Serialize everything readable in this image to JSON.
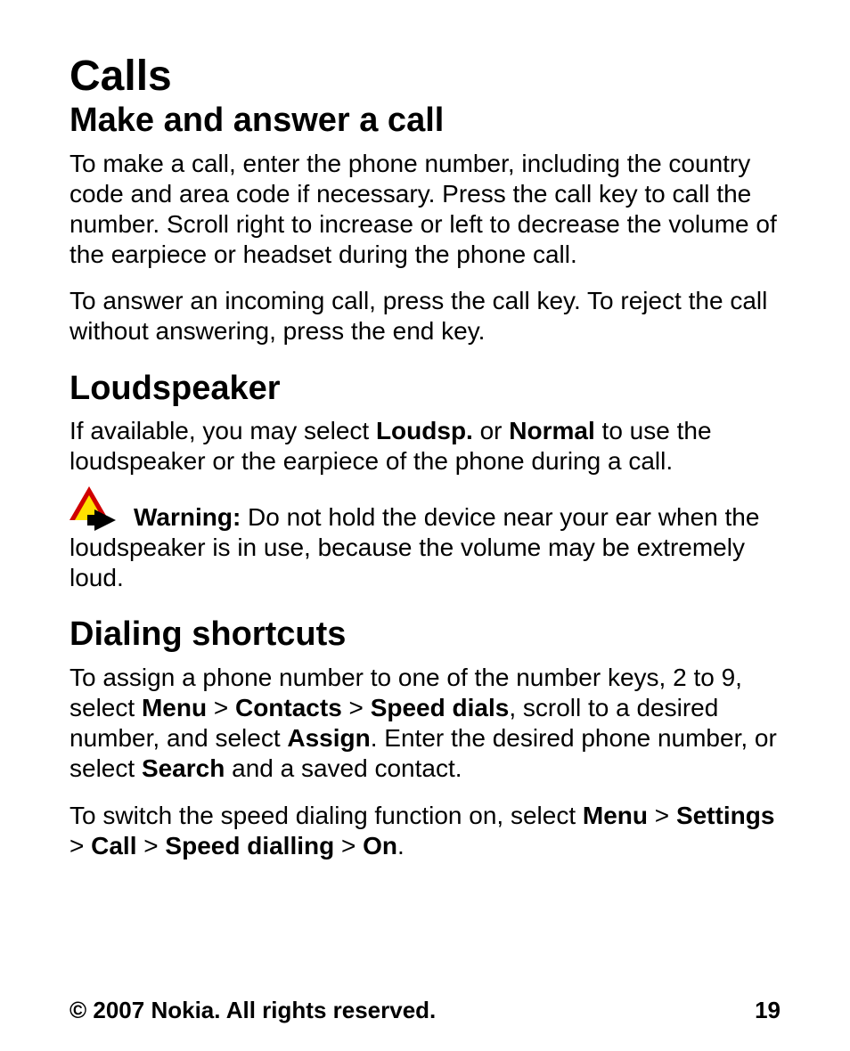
{
  "h1": "Calls",
  "sec1": {
    "title": "Make and answer a call",
    "p1": "To make a call, enter the phone number, including the country code and area code if necessary. Press the call key to call the number. Scroll right to increase or left to decrease the volume of the earpiece or headset during the phone call.",
    "p2": "To answer an incoming call, press the call key. To reject the call without answering, press the end key."
  },
  "sec2": {
    "title": "Loudspeaker",
    "p1_a": "If available, you may select ",
    "p1_b": "Loudsp.",
    "p1_c": " or ",
    "p1_d": "Normal",
    "p1_e": " to use the loudspeaker or the earpiece of the phone during a call.",
    "warn_label": "Warning:",
    "warn_text": "  Do not hold the device near your ear when the loudspeaker is in use, because the volume may be extremely loud."
  },
  "sec3": {
    "title": "Dialing shortcuts",
    "p1_a": "To assign a phone number to one of the number keys, 2 to 9, select ",
    "p1_menu": "Menu",
    "gt": " > ",
    "p1_contacts": "Contacts",
    "p1_speed": "Speed dials",
    "p1_b": ", scroll to a desired number, and select ",
    "p1_assign": "Assign",
    "p1_c": ". Enter the desired phone number, or select ",
    "p1_search": "Search",
    "p1_d": " and a saved contact.",
    "p2_a": "To switch the speed dialing function on, select ",
    "p2_menu": "Menu",
    "p2_settings": "Settings",
    "p2_call": "Call",
    "p2_speed": "Speed dialling",
    "p2_on": "On",
    "p2_end": "."
  },
  "footer": {
    "copyright": "© 2007 Nokia. All rights reserved.",
    "page": "19"
  }
}
